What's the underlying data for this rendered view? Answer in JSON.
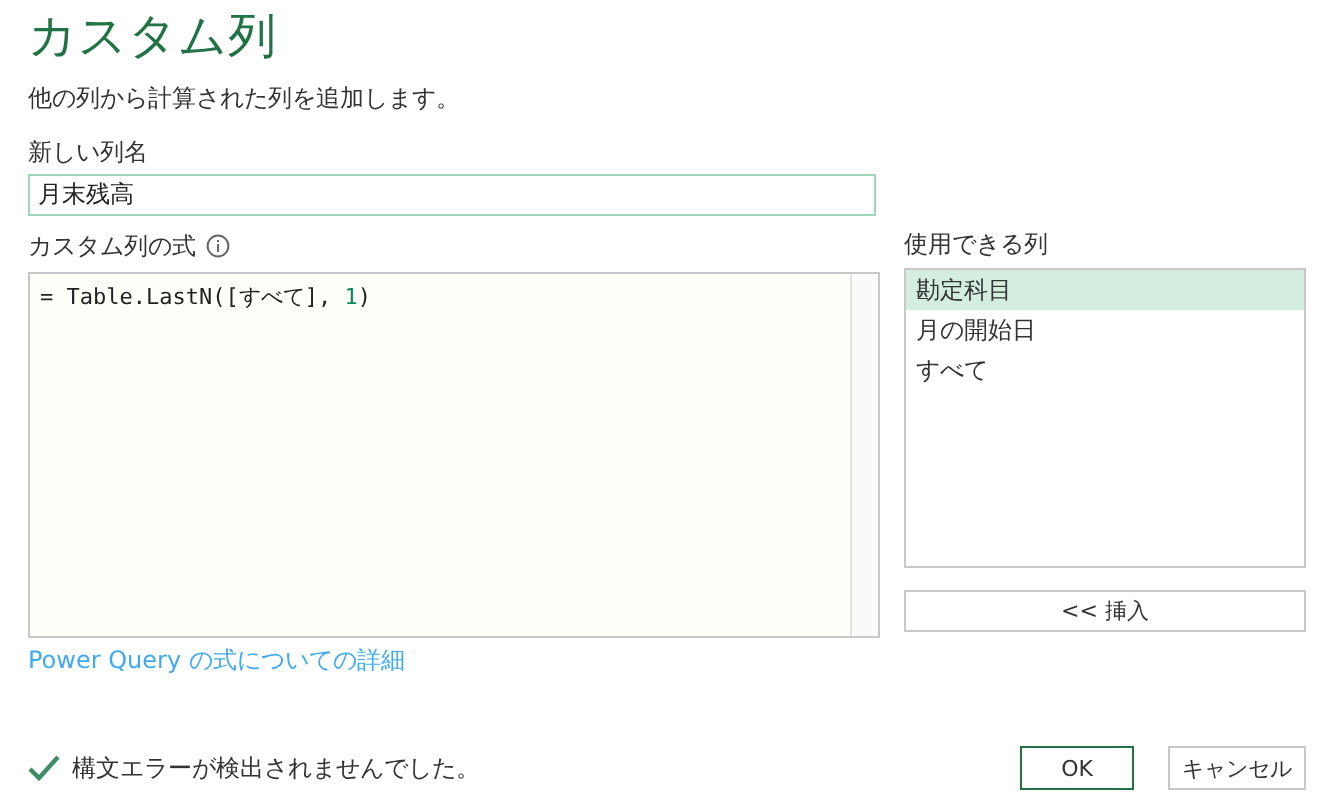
{
  "title": "カスタム列",
  "description": "他の列から計算された列を追加します。",
  "new_column": {
    "label": "新しい列名",
    "value": "月末残高"
  },
  "formula": {
    "label": "カスタム列の式",
    "tokens": [
      {
        "kind": "code",
        "text": "= Table.LastN([すべて], "
      },
      {
        "kind": "number",
        "text": "1"
      },
      {
        "kind": "code",
        "text": ")"
      }
    ]
  },
  "available_columns": {
    "label": "使用できる列",
    "items": [
      {
        "label": "勘定科目",
        "selected": true
      },
      {
        "label": "月の開始日",
        "selected": false
      },
      {
        "label": "すべて",
        "selected": false
      }
    ],
    "insert_button": "<< 挿入"
  },
  "help_link": "Power Query の式についての詳細",
  "status": {
    "ok": true,
    "text": "構文エラーが検出されませんでした。"
  },
  "buttons": [
    {
      "label": "OK",
      "primary": true
    },
    {
      "label": "キャンセル",
      "primary": false
    }
  ]
}
